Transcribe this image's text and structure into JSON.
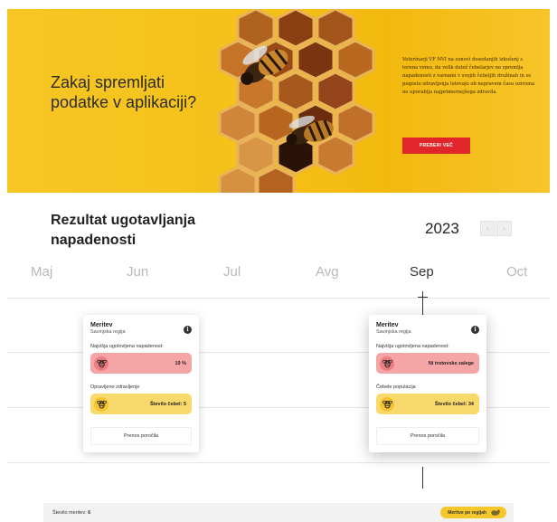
{
  "hero": {
    "title": "Zakaj spremljati podatke v aplikaciji?",
    "text": "Veterinarji VF NVI na osnovi dosedanjih izkušenj s terena vemo, da velik delež čebelarjev ne spremlja napadenosti z varoami v svojih čebeljih družinah in se pogosto zdravljenja lotevajo ob nepravem času oziroma ne uporablja najprimernejšega zdravila.",
    "button_label": "PREBERI VEČ"
  },
  "results": {
    "title": "Rezultat ugotavljanja napadenosti",
    "year": "2023",
    "prev_label": "‹",
    "next_label": "›"
  },
  "months": [
    "Maj",
    "Jun",
    "Jul",
    "Avg",
    "Sep",
    "Oct"
  ],
  "active_month": "Sep",
  "cards": [
    {
      "title": "Meritev",
      "subtitle": "Savinjska regija",
      "infestation_label": "Najvišja ugotovljena napadenost:",
      "infestation_value": "19 %",
      "section2_label": "Opravljeno zdravljenje",
      "bees_value": "Število čebel: 5",
      "report_label": "Prenos poročila"
    },
    {
      "title": "Meritev",
      "subtitle": "Savinjska regija",
      "infestation_label": "Najvišja ugotovljena napadenost:",
      "infestation_value": "Ni trotovske zalege",
      "section2_label": "Čebele populacija",
      "bees_value": "Število čebel: 34",
      "report_label": "Prenos poročila"
    }
  ],
  "footer": {
    "count_label": "Število meritev: ",
    "count_value": "6",
    "region_button": "Meritve po regijah"
  },
  "colors": {
    "accent_yellow": "#f6c72b",
    "alert_red": "#e0262a",
    "pill_red": "#f6a5a7",
    "pill_yellow": "#fad96c"
  }
}
